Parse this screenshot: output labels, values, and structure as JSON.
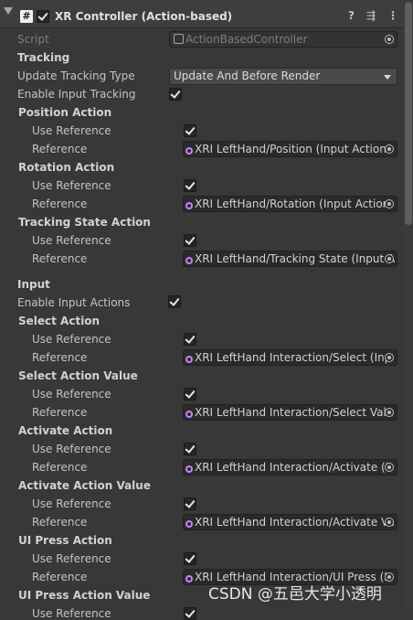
{
  "header": {
    "script_icon": "#",
    "title": "XR Controller (Action-based)",
    "enabled": true,
    "icons": [
      "help-icon",
      "preset-icon",
      "kebab-menu-icon"
    ],
    "help_glyph": "?",
    "preset_glyph": "⇶",
    "menu_glyph": "⋮"
  },
  "script": {
    "label": "Script",
    "value": "ActionBasedController"
  },
  "tracking": {
    "heading": "Tracking",
    "update_label": "Update Tracking Type",
    "update_value": "Update And Before Render",
    "enable_label": "Enable Input Tracking",
    "enable_checked": true
  },
  "labels": {
    "use_reference": "Use Reference",
    "reference": "Reference"
  },
  "tracking_actions": [
    {
      "heading": "Position Action",
      "use_reference": true,
      "reference": "XRI LeftHand/Position (Input Action"
    },
    {
      "heading": "Rotation Action",
      "use_reference": true,
      "reference": "XRI LeftHand/Rotation (Input Action"
    },
    {
      "heading": "Tracking State Action",
      "use_reference": true,
      "reference": "XRI LeftHand/Tracking State (Input A"
    }
  ],
  "input": {
    "heading": "Input",
    "enable_label": "Enable Input Actions",
    "enable_checked": true
  },
  "input_actions": [
    {
      "heading": "Select Action",
      "use_reference": true,
      "reference": "XRI LeftHand Interaction/Select (Inp"
    },
    {
      "heading": "Select Action Value",
      "use_reference": true,
      "reference": "XRI LeftHand Interaction/Select Valu"
    },
    {
      "heading": "Activate Action",
      "use_reference": true,
      "reference": "XRI LeftHand Interaction/Activate (Ir"
    },
    {
      "heading": "Activate Action Value",
      "use_reference": true,
      "reference": "XRI LeftHand Interaction/Activate Va"
    },
    {
      "heading": "UI Press Action",
      "use_reference": true,
      "reference": "XRI LeftHand Interaction/UI Press (Ir"
    },
    {
      "heading": "UI Press Action Value",
      "use_reference": true,
      "reference": ""
    }
  ],
  "watermark": "CSDN @五邑大学小透明"
}
